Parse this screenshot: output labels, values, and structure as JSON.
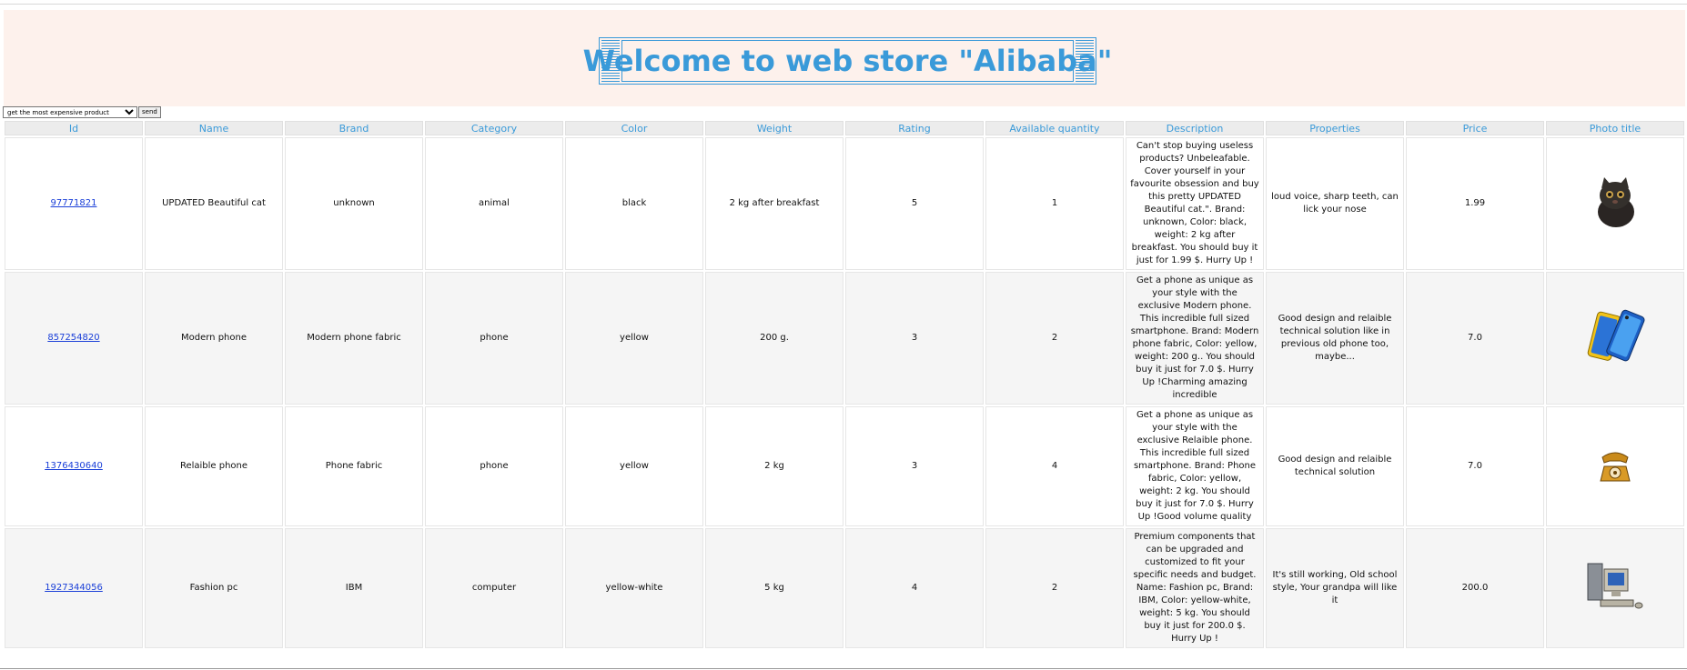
{
  "header": {
    "title": "Welcome to web store \"Alibaba\""
  },
  "controls": {
    "select_value": "get the most expensive product",
    "send_label": "send"
  },
  "table": {
    "headers": [
      "Id",
      "Name",
      "Brand",
      "Category",
      "Color",
      "Weight",
      "Rating",
      "Available quantity",
      "Description",
      "Properties",
      "Price",
      "Photo title"
    ],
    "rows": [
      {
        "id": "97771821",
        "name": "UPDATED Beautiful cat",
        "brand": "unknown",
        "category": "animal",
        "color": "black",
        "weight": "2 kg after breakfast",
        "rating": "5",
        "quantity": "1",
        "description": "Can't stop buying useless products? Unbeleafable. Cover yourself in your favourite obsession and buy this pretty UPDATED Beautiful cat.\". Brand: unknown, Color: black, weight: 2 kg after breakfast. You should buy it just for 1.99 $. Hurry Up !",
        "properties": "loud voice, sharp teeth, can lick your nose",
        "price": "1.99",
        "photo_icon": "cat-photo"
      },
      {
        "id": "857254820",
        "name": "Modern phone",
        "brand": "Modern phone fabric",
        "category": "phone",
        "color": "yellow",
        "weight": "200 g.",
        "rating": "3",
        "quantity": "2",
        "description": "Get a phone as unique as your style with the exclusive Modern phone. This incredible full sized smartphone. Brand: Modern phone fabric, Color: yellow, weight: 200 g.. You should buy it just for 7.0 $. Hurry Up !Charming amazing incredible",
        "properties": "Good design and relaible technical solution like in previous old phone too, maybe...",
        "price": "7.0",
        "photo_icon": "smartphone-photo"
      },
      {
        "id": "1376430640",
        "name": "Relaible phone",
        "brand": "Phone fabric",
        "category": "phone",
        "color": "yellow",
        "weight": "2 kg",
        "rating": "3",
        "quantity": "4",
        "description": "Get a phone as unique as your style with the exclusive Relaible phone. This incredible full sized smartphone. Brand: Phone fabric, Color: yellow, weight: 2 kg. You should buy it just for 7.0 $. Hurry Up !Good volume quality",
        "properties": "Good design and relaible technical solution",
        "price": "7.0",
        "photo_icon": "rotary-phone-photo"
      },
      {
        "id": "1927344056",
        "name": "Fashion pc",
        "brand": "IBM",
        "category": "computer",
        "color": "yellow-white",
        "weight": "5 kg",
        "rating": "4",
        "quantity": "2",
        "description": "Premium components that can be upgraded and customized to fit your specific needs and budget. Name: Fashion pc, Brand: IBM, Color: yellow-white, weight: 5 kg. You should buy it just for 200.0 $. Hurry Up !",
        "properties": "It's still working, Old school style, Your grandpa will like it",
        "price": "200.0",
        "photo_icon": "retro-computer-photo"
      }
    ]
  },
  "colors": {
    "accent": "#3a9ad9",
    "header_bg": "#fdf1ec",
    "link": "#1a3fd8"
  }
}
